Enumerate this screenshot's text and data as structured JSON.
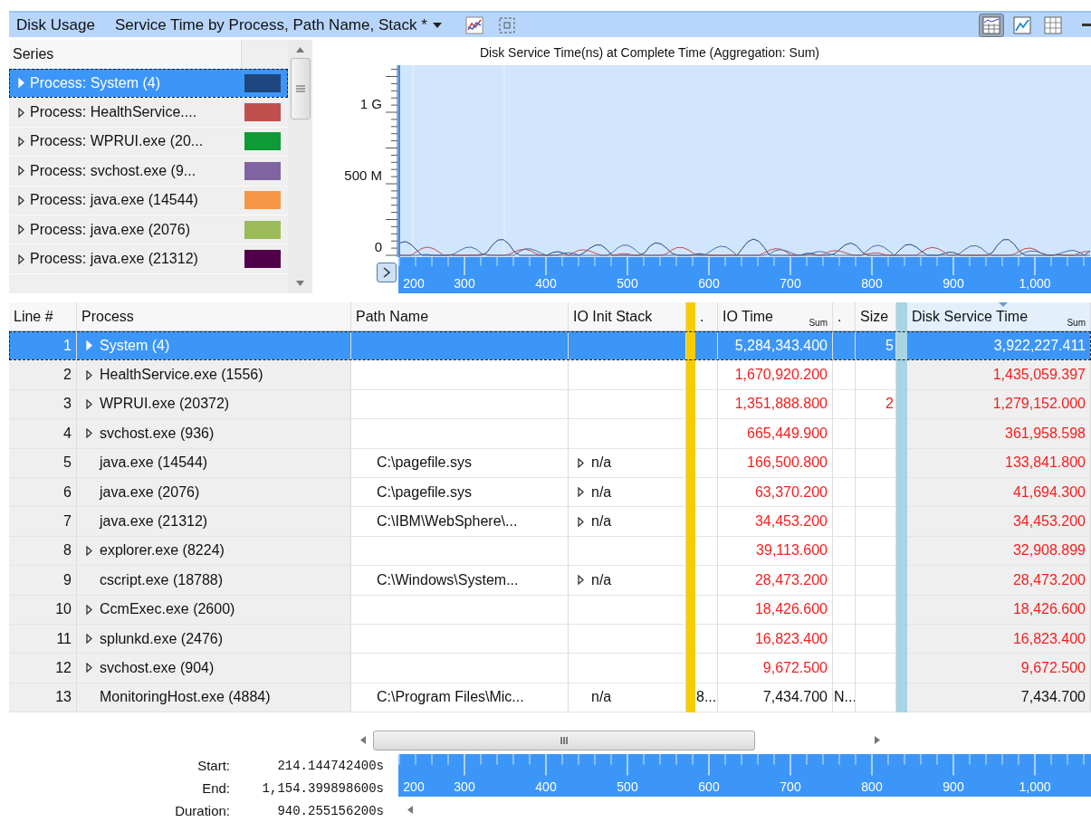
{
  "toolbar": {
    "title": "Disk Usage",
    "preset": "Service Time by Process, Path Name, Stack *",
    "views": [
      {
        "kind": "graph-table",
        "selected": true
      },
      {
        "kind": "graph",
        "selected": false
      },
      {
        "kind": "table",
        "selected": false
      }
    ]
  },
  "series_panel": {
    "header": "Series",
    "items": [
      {
        "label": "Process: System (4)",
        "color": "#1f477f",
        "selected": true
      },
      {
        "label": "Process: HealthService....",
        "color": "#c0504d",
        "selected": false
      },
      {
        "label": "Process: WPRUI.exe (20...",
        "color": "#0e9a37",
        "selected": false
      },
      {
        "label": "Process: svchost.exe (9...",
        "color": "#8064a2",
        "selected": false
      },
      {
        "label": "Process: java.exe (14544)",
        "color": "#f79646",
        "selected": false
      },
      {
        "label": "Process: java.exe (2076)",
        "color": "#9bbb59",
        "selected": false
      },
      {
        "label": "Process: java.exe (21312)",
        "color": "#4f0048",
        "selected": false
      }
    ]
  },
  "chart": {
    "title": "Disk Service Time(ns) at Complete Time (Aggregation: Sum)",
    "y_ticks": [
      "1 G",
      "500 M",
      "0"
    ],
    "x_ticks": [
      "200",
      "300",
      "400",
      "500",
      "600",
      "700",
      "800",
      "900",
      "1,000"
    ]
  },
  "table": {
    "columns": [
      {
        "label": "Line #"
      },
      {
        "label": "Process"
      },
      {
        "label": "Path Name"
      },
      {
        "label": "IO Init Stack"
      },
      {
        "label": "."
      },
      {
        "label": "IO Time",
        "aggregate": "Sum"
      },
      {
        "label": "."
      },
      {
        "label": "Size"
      },
      {
        "label": "Disk Service Time",
        "aggregate": "Sum",
        "sorted": true
      }
    ],
    "rows": [
      {
        "line": "1",
        "process": "System (4)",
        "expandable": true,
        "io_time": "5,284,343.400",
        "size": "5",
        "service_time": "3,922,227.411",
        "emphasized": false,
        "selected": true
      },
      {
        "line": "2",
        "process": "HealthService.exe (1556)",
        "expandable": true,
        "io_time": "1,670,920.200",
        "service_time": "1,435,059.397",
        "emphasized": true,
        "selected": false
      },
      {
        "line": "3",
        "process": "WPRUI.exe (20372)",
        "expandable": true,
        "io_time": "1,351,888.800",
        "size": "2",
        "service_time": "1,279,152.000",
        "emphasized": true,
        "selected": false
      },
      {
        "line": "4",
        "process": "svchost.exe (936)",
        "expandable": true,
        "io_time": "665,449.900",
        "service_time": "361,958.598",
        "emphasized": true,
        "selected": false
      },
      {
        "line": "5",
        "process": "java.exe (14544)",
        "expandable": false,
        "path": "C:\\pagefile.sys",
        "stack": "n/a",
        "stack_expandable": true,
        "io_time": "166,500.800",
        "service_time": "133,841.800",
        "emphasized": true,
        "selected": false
      },
      {
        "line": "6",
        "process": "java.exe (2076)",
        "expandable": false,
        "path": "C:\\pagefile.sys",
        "stack": "n/a",
        "stack_expandable": true,
        "io_time": "63,370.200",
        "service_time": "41,694.300",
        "emphasized": true,
        "selected": false
      },
      {
        "line": "7",
        "process": "java.exe (21312)",
        "expandable": false,
        "path": "C:\\IBM\\WebSphere\\...",
        "stack": "n/a",
        "stack_expandable": true,
        "io_time": "34,453.200",
        "service_time": "34,453.200",
        "emphasized": true,
        "selected": false
      },
      {
        "line": "8",
        "process": "explorer.exe (8224)",
        "expandable": true,
        "io_time": "39,113.600",
        "service_time": "32,908.899",
        "emphasized": true,
        "selected": false
      },
      {
        "line": "9",
        "process": "cscript.exe (18788)",
        "expandable": false,
        "path": "C:\\Windows\\System...",
        "stack": "n/a",
        "stack_expandable": true,
        "io_time": "28,473.200",
        "service_time": "28,473.200",
        "emphasized": true,
        "selected": false
      },
      {
        "line": "10",
        "process": "CcmExec.exe (2600)",
        "expandable": true,
        "io_time": "18,426.600",
        "service_time": "18,426.600",
        "emphasized": true,
        "selected": false
      },
      {
        "line": "11",
        "process": "splunkd.exe (2476)",
        "expandable": true,
        "io_time": "16,823.400",
        "service_time": "16,823.400",
        "emphasized": true,
        "selected": false
      },
      {
        "line": "12",
        "process": "svchost.exe (904)",
        "expandable": true,
        "io_time": "9,672.500",
        "service_time": "9,672.500",
        "emphasized": true,
        "selected": false
      },
      {
        "line": "13",
        "process": "MonitoringHost.exe (4884)",
        "expandable": false,
        "path": "C:\\Program Files\\Mic...",
        "stack": "n/a",
        "stack_expandable": false,
        "col_a": "8...",
        "io_time": "7,434.700",
        "col_b": "N...",
        "service_time": "7,434.700",
        "emphasized": false,
        "selected": false
      }
    ],
    "scroll_thumb": "III"
  },
  "time_range": [
    {
      "label": "Start:",
      "value": "214.144742400s"
    },
    {
      "label": "End:",
      "value": "1,154.399898600s"
    },
    {
      "label": "Duration:",
      "value": "940.255156200s"
    }
  ],
  "time_axis": {
    "ticks": [
      "200",
      "300",
      "400",
      "500",
      "600",
      "700",
      "800",
      "900",
      "1,000"
    ]
  }
}
